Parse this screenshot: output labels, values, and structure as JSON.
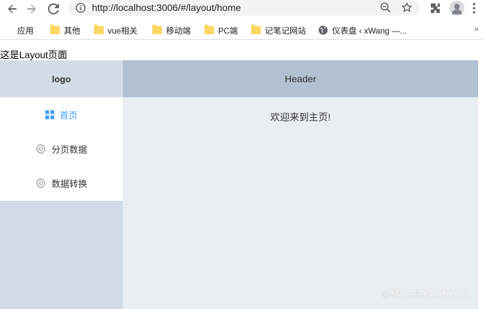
{
  "browser": {
    "url": "http://localhost:3006/#/layout/home",
    "bookmarks": [
      {
        "label": "应用",
        "icon": "apps-grid-icon"
      },
      {
        "label": "其他",
        "icon": "folder-icon"
      },
      {
        "label": "vue相关",
        "icon": "folder-icon"
      },
      {
        "label": "移动端",
        "icon": "folder-icon"
      },
      {
        "label": "PC端",
        "icon": "folder-icon"
      },
      {
        "label": "记笔记网站",
        "icon": "folder-icon"
      },
      {
        "label": "仪表盘 ‹ xWang —...",
        "icon": "globe-icon"
      }
    ],
    "more_bookmarks": "»"
  },
  "page": {
    "intro": "这是Layout页面",
    "logo": "logo",
    "header": "Header",
    "menu": [
      {
        "label": "首页",
        "icon": "grid-icon",
        "active": true
      },
      {
        "label": "分页数据",
        "icon": "gear-icon",
        "active": false
      },
      {
        "label": "数据转换",
        "icon": "gear-icon",
        "active": false
      }
    ],
    "welcome": "欢迎来到主页!"
  },
  "watermark": "@稀土掘金技术社区",
  "colors": {
    "sider": "#d3dce6",
    "header": "#b3c0d1",
    "main": "#e9eef3",
    "active_menu": "#409eff"
  }
}
